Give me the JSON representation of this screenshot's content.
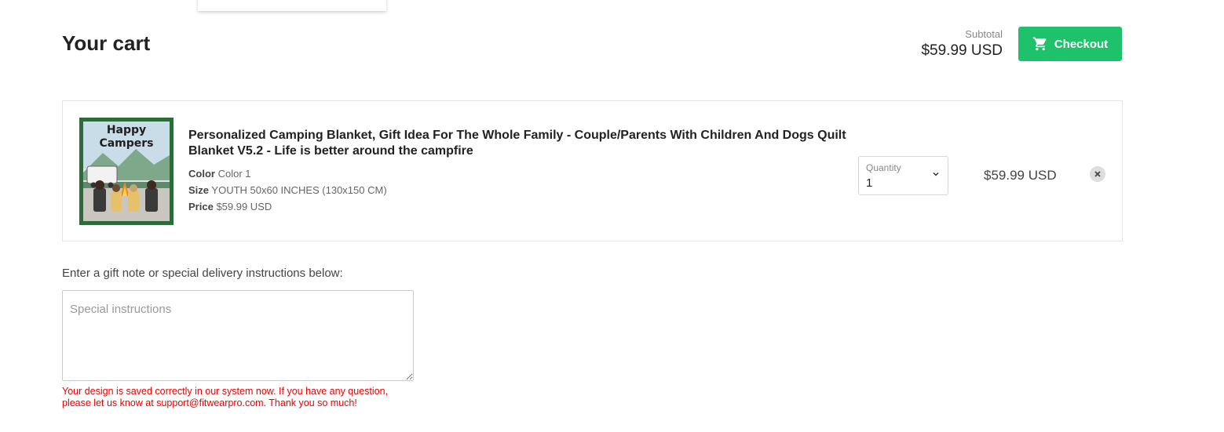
{
  "page": {
    "title": "Your cart"
  },
  "summary": {
    "subtotal_label": "Subtotal",
    "subtotal_amount": "$59.99 USD",
    "checkout_label": "Checkout",
    "checkout_color": "#1dc26a"
  },
  "cart": {
    "items": [
      {
        "title": "Personalized Camping Blanket, Gift Idea For The Whole Family - Couple/Parents With Children And Dogs Quilt Blanket V5.2 - Life is better around the campfire",
        "image_text": "Happy Campers",
        "properties": [
          {
            "name": "Color",
            "value": "Color 1"
          },
          {
            "name": "Size",
            "value": "YOUTH 50x60 INCHES (130x150 CM)"
          },
          {
            "name": "Price",
            "value": "$59.99 USD"
          }
        ],
        "quantity_label": "Quantity",
        "quantity": "1",
        "line_price": "$59.99 USD",
        "remove_icon": "close-icon"
      }
    ]
  },
  "note": {
    "label": "Enter a gift note or special delivery instructions below:",
    "placeholder": "Special instructions",
    "value": ""
  },
  "message": {
    "text": "Your design is saved correctly in our system now. If you have any question, please let us know at support@fitwearpro.com. Thank you so much!",
    "color": "#e00000"
  }
}
